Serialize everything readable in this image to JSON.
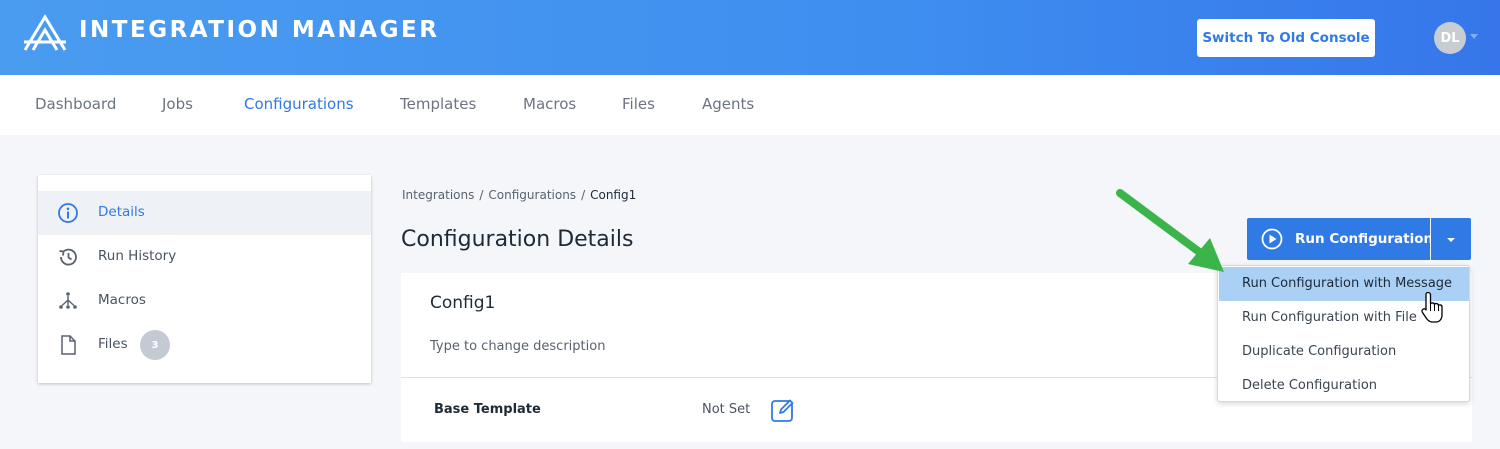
{
  "header": {
    "app_title": "INTEGRATION MANAGER",
    "switch_label": "Switch To Old Console",
    "avatar_initials": "DL",
    "logo_icon": "integration-manager-logo"
  },
  "nav": {
    "items": [
      {
        "label": "Dashboard",
        "active": false
      },
      {
        "label": "Jobs",
        "active": false
      },
      {
        "label": "Configurations",
        "active": true
      },
      {
        "label": "Templates",
        "active": false
      },
      {
        "label": "Macros",
        "active": false
      },
      {
        "label": "Files",
        "active": false
      },
      {
        "label": "Agents",
        "active": false
      }
    ]
  },
  "sidebar": {
    "items": [
      {
        "label": "Details",
        "icon": "info-icon",
        "active": true
      },
      {
        "label": "Run History",
        "icon": "history-icon",
        "active": false
      },
      {
        "label": "Macros",
        "icon": "macros-icon",
        "active": false
      },
      {
        "label": "Files",
        "icon": "file-icon",
        "active": false,
        "badge": "3"
      }
    ]
  },
  "breadcrumb": {
    "items": [
      "Integrations",
      "Configurations",
      "Config1"
    ],
    "separator": "/"
  },
  "main": {
    "page_title": "Configuration Details",
    "run_button_label": "Run Configuration",
    "card": {
      "title": "Config1",
      "description": "Type to change description",
      "field_label": "Base Template",
      "field_value": "Not Set"
    }
  },
  "dropdown": {
    "items": [
      {
        "label": "Run Configuration with Message",
        "hovered": true
      },
      {
        "label": "Run Configuration with File",
        "hovered": false
      },
      {
        "label": "Duplicate Configuration",
        "hovered": false
      },
      {
        "label": "Delete Configuration",
        "hovered": false
      }
    ]
  },
  "colors": {
    "header_gradient_start": "#4a9cf0",
    "header_gradient_end": "#3676ea",
    "accent": "#2f7ae5",
    "menu_hover": "#aad0f5",
    "annotation_arrow": "#3bb54a"
  }
}
